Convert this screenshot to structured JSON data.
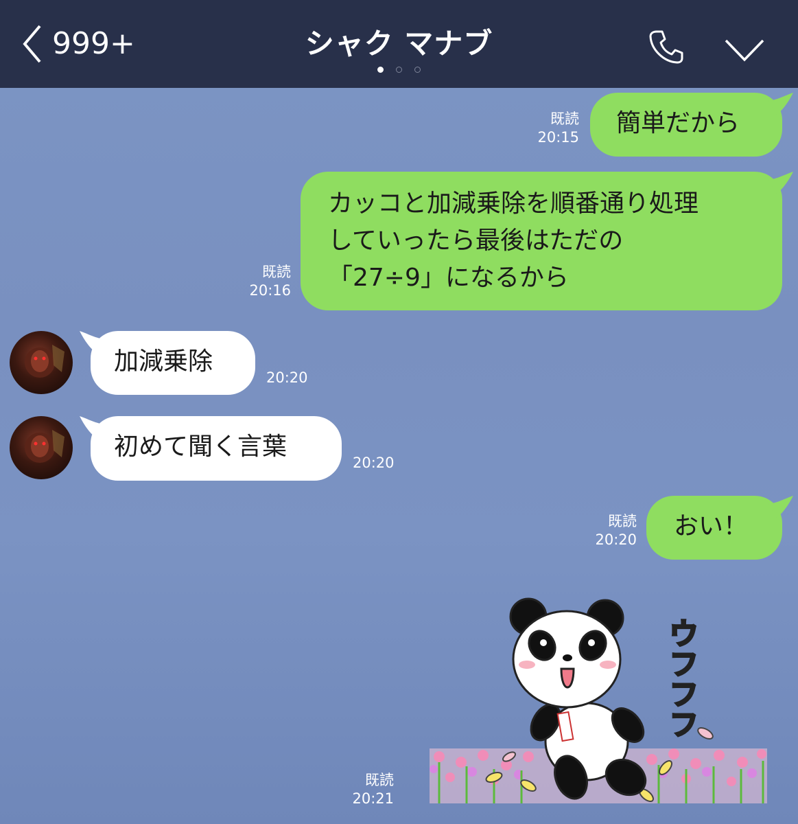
{
  "header": {
    "back_count": "999+",
    "title": "シャク マナブ",
    "page_indicator": {
      "count": 3,
      "active": 0
    }
  },
  "messages": [
    {
      "from": "me",
      "text": "簡単だから",
      "read": "既読",
      "time": "20:15"
    },
    {
      "from": "me",
      "lines": [
        "カッコと加減乗除を順番通り処理",
        "していったら最後はただの",
        "「27÷9」になるから"
      ],
      "read": "既読",
      "time": "20:16"
    },
    {
      "from": "them",
      "text": "加減乗除",
      "time": "20:20"
    },
    {
      "from": "them",
      "text": "初めて聞く言葉",
      "time": "20:20"
    },
    {
      "from": "me",
      "text": "おい！",
      "read": "既読",
      "time": "20:20"
    },
    {
      "from": "me",
      "type": "sticker",
      "sticker_text": "ウフフフ",
      "read": "既読",
      "time": "20:21"
    }
  ],
  "colors": {
    "header": "#28304a",
    "my_bubble": "#8fdd60",
    "their_bubble": "#ffffff",
    "background": "#7b93c3"
  }
}
